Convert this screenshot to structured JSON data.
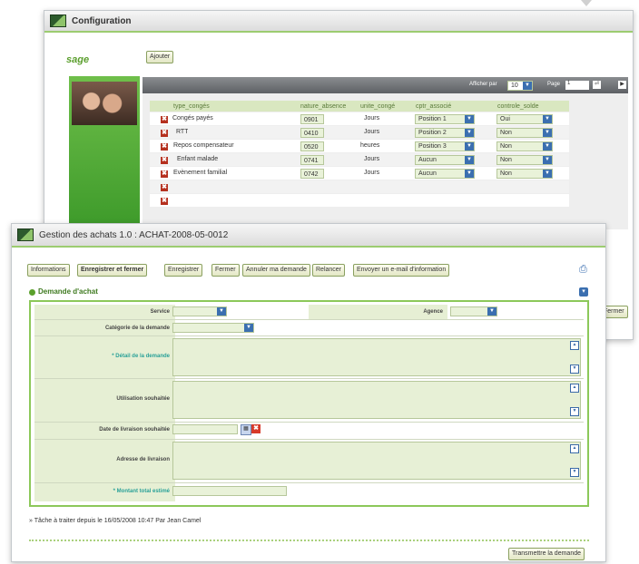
{
  "config": {
    "title": "Configuration",
    "logo": "sage",
    "add_label": "Ajouter",
    "pager": {
      "show_label": "Afficher par",
      "per_page": "10",
      "page_label": "Page",
      "page_value": "1"
    },
    "columns": [
      "type_congés",
      "nature_absence",
      "unite_congé",
      "cptr_associé",
      "controle_solde"
    ],
    "rows": [
      {
        "type": "Congés payés",
        "code": "0901",
        "unit": "Jours",
        "position": "Position 1",
        "control": "Oui"
      },
      {
        "type": "RTT",
        "code": "0410",
        "unit": "Jours",
        "position": "Position 2",
        "control": "Non"
      },
      {
        "type": "Repos compensateur",
        "code": "0520",
        "unit": "heures",
        "position": "Position 3",
        "control": "Non"
      },
      {
        "type": "Enfant malade",
        "code": "0741",
        "unit": "Jours",
        "position": "Aucun",
        "control": "Non"
      },
      {
        "type": "Evènement familial",
        "code": "0742",
        "unit": "Jours",
        "position": "Aucun",
        "control": "Non"
      }
    ],
    "close_label": "Fermer"
  },
  "gestion": {
    "title": "Gestion des achats 1.0 : ACHAT-2008-05-0012",
    "toolbar": {
      "informations": "Informations",
      "save_close": "Enregistrer et fermer",
      "save": "Enregistrer",
      "close": "Fermer",
      "cancel_request": "Annuler ma demande",
      "remind": "Relancer",
      "send_email": "Envoyer un e-mail d'information"
    },
    "section_title": "Demande d'achat",
    "fields": {
      "service": "Service",
      "agence": "Agence",
      "categorie": "Catégorie de la demande",
      "detail": "* Détail de la demande",
      "utilisation": "Utilisation souhaitée",
      "date_livraison": "Date de livraison souhaitée",
      "adresse": "Adresse de livraison",
      "montant": "* Montant total estimé"
    },
    "task_note": "» Tâche à traiter depuis le 16/05/2008 10:47 Par Jean Camel",
    "submit_label": "Transmettre la demande"
  }
}
